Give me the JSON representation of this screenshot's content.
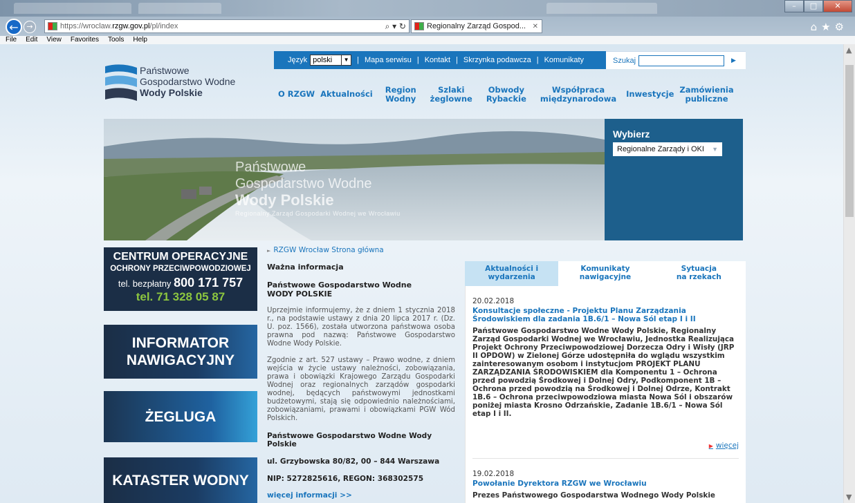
{
  "browser": {
    "url_prefix": "https://wroclaw.",
    "url_domain": "rzgw.gov.pl",
    "url_suffix": "/pl/index",
    "tab_title": "Regionalny Zarząd Gospod...",
    "menu": [
      "File",
      "Edit",
      "View",
      "Favorites",
      "Tools",
      "Help"
    ]
  },
  "logo": {
    "line1": "Państwowe",
    "line2": "Gospodarstwo Wodne",
    "line3": "Wody Polskie"
  },
  "utilbar": {
    "language_label": "Język",
    "language_value": "polski",
    "links": [
      "Mapa serwisu",
      "Kontakt",
      "Skrzynka podawcza",
      "Komunikaty"
    ],
    "search_label": "Szukaj"
  },
  "mainnav": [
    "O RZGW",
    "Aktualności",
    "Region\nWodny",
    "Szlaki\nżeglowne",
    "Obwody\nRybackie",
    "Współpraca\nmiędzynarodowa",
    "Inwestycje",
    "Zamówienia\npubliczne"
  ],
  "banner": {
    "line1": "Państwowe",
    "line2": "Gospodarstwo Wodne",
    "line3": "Wody Polskie",
    "line4": "Regionalny Zarząd Gospodarki Wodnej we Wrocławiu",
    "select_title": "Wybierz",
    "select_value": "Regionalne Zarządy i OKI"
  },
  "left": {
    "centrum_l1": "CENTRUM OPERACYJNE",
    "centrum_l2": "OCHRONY PRZECIWPOWODZIOWEJ",
    "centrum_l3_prefix": "tel. bezpłatny",
    "centrum_l3_number": "800 171 757",
    "centrum_l4": "tel. 71 328 05 87",
    "informator": "INFORMATOR\nNAWIGACYJNY",
    "zegluga": "ŻEGLUGA",
    "kataster": "KATASTER WODNY"
  },
  "middle": {
    "breadcrumb": "RZGW Wrocław Strona główna",
    "heading": "Ważna informacja",
    "org_l1": "Państwowe Gospodarstwo Wodne",
    "org_l2": "WODY POLSKIE",
    "para1": "Uprzejmie informujemy, że z dniem 1 stycznia 2018 r., na podstawie ustawy z dnia 20 lipca 2017 r. (Dz. U. poz. 1566), została utworzona państwowa osoba prawna pod nazwą: Państwowe Gospodarstwo Wodne Wody Polskie.",
    "para2": "Zgodnie z art. 527 ustawy – Prawo wodne, z dniem wejścia w życie ustawy należności, zobowiązania, prawa i obowiązki Krajowego Zarządu Gospodarki Wodnej oraz regionalnych zarządów gospodarki wodnej, będących państwowymi jednostkami budżetowymi, stają się odpowiednio należnościami, zobowiązaniami, prawami i obowiązkami PGW Wód Polskich.",
    "bold1": "Państwowe Gospodarstwo Wodne Wody Polskie",
    "bold2": "ul. Grzybowska 80/82, 00 – 844 Warszawa",
    "bold3": "NIP: 5272825616, REGON: 368302575",
    "more": "więcej informacji >>"
  },
  "news": {
    "tabs": [
      "Aktualności i\nwydarzenia",
      "Komunikaty\nnawigacyjne",
      "Sytuacja\nna rzekach"
    ],
    "item1_date": "20.02.2018",
    "item1_title": "Konsultacje społeczne - Projektu Planu Zarządzania Środowiskiem dla zadania 1B.6/1 – Nowa Sól etap I i II",
    "item1_text": "Państwowe Gospodarstwo Wodne Wody Polskie, Regionalny Zarząd Gospodarki Wodnej we Wrocławiu, Jednostka Realizująca Projekt Ochrony Przeciwpowodziowej Dorzecza Odry i Wisły (JRP II OPDOW) w Zielonej Górze udostępniła do wglądu wszystkim zainteresowanym osobom i instytucjom PROJEKT PLANU ZARZĄDZANIA ŚRODOWISKIEM dla Komponentu 1 – Ochrona przed powodzią Środkowej i Dolnej Odry, Podkomponent 1B – Ochrona przed powodzią na Środkowej i Dolnej Odrze, Kontrakt 1B.6 – Ochrona przeciwpowodziowa miasta Nowa Sól i obszarów poniżej miasta Krosno Odrzańskie, Zadanie 1B.6/1 – Nowa Sól etap I i II.",
    "more": "więcej",
    "item2_date": "19.02.2018",
    "item2_title": "Powołanie Dyrektora RZGW we Wrocławiu",
    "item2_text": "Prezes Państwowego Gospodarstwa Wodnego Wody Polskie"
  }
}
